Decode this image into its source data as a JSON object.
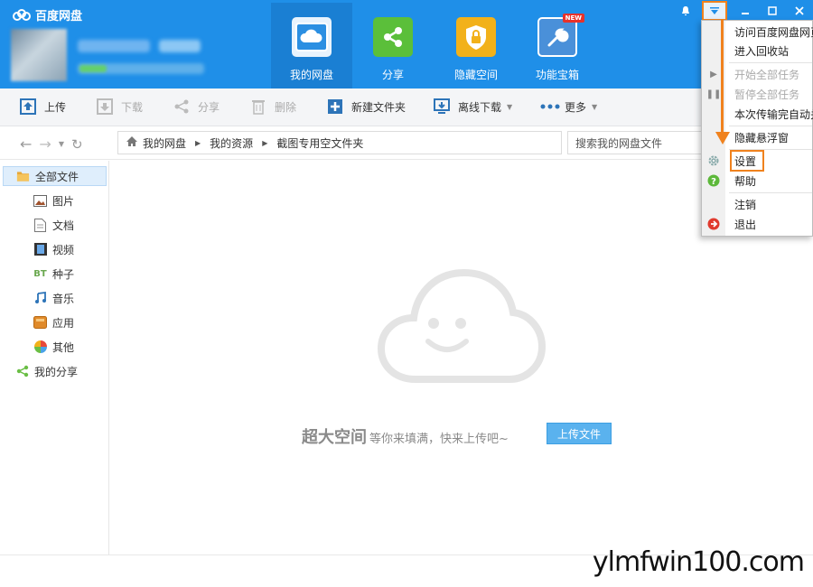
{
  "app": {
    "title": "百度网盘"
  },
  "nav_tabs": [
    {
      "label": "我的网盘",
      "icon": "cloud-icon",
      "active": true
    },
    {
      "label": "分享",
      "icon": "share-icon",
      "active": false
    },
    {
      "label": "隐藏空间",
      "icon": "lock-icon",
      "active": false
    },
    {
      "label": "功能宝箱",
      "icon": "toolbox-icon",
      "active": false,
      "badge": "NEW"
    }
  ],
  "toolbar": {
    "upload": "上传",
    "download": "下载",
    "share": "分享",
    "delete": "删除",
    "new_folder": "新建文件夹",
    "offline_download": "离线下载",
    "more": "更多"
  },
  "breadcrumb": [
    "我的网盘",
    "我的资源",
    "截图专用空文件夹"
  ],
  "search": {
    "placeholder": "搜索我的网盘文件"
  },
  "sidebar": {
    "items": [
      {
        "label": "全部文件",
        "icon": "folder-icon"
      },
      {
        "label": "图片",
        "icon": "image-icon"
      },
      {
        "label": "文档",
        "icon": "document-icon"
      },
      {
        "label": "视频",
        "icon": "video-icon"
      },
      {
        "label": "种子",
        "icon": "bt-icon",
        "icon_text": "BT"
      },
      {
        "label": "音乐",
        "icon": "music-icon"
      },
      {
        "label": "应用",
        "icon": "app-icon"
      },
      {
        "label": "其他",
        "icon": "other-icon"
      },
      {
        "label": "我的分享",
        "icon": "share-icon"
      }
    ]
  },
  "empty_state": {
    "headline": "超大空间",
    "message": "等你来填满，快来上传吧~",
    "button": "上传文件"
  },
  "menu": {
    "items": [
      {
        "label": "访问百度网盘网页"
      },
      {
        "label": "进入回收站"
      },
      {
        "label": "开始全部任务",
        "disabled": true
      },
      {
        "label": "暂停全部任务",
        "disabled": true
      },
      {
        "label": "本次传输完自动关机"
      },
      {
        "label": "隐藏悬浮窗"
      },
      {
        "label": "设置"
      },
      {
        "label": "帮助"
      },
      {
        "label": "注销"
      },
      {
        "label": "退出"
      }
    ]
  },
  "watermark": "ylmfwin100.com",
  "colors": {
    "header_bg": "#1f8fe8",
    "active_tab_bg": "#1a7fd3",
    "highlight": "#f0821e",
    "upload_button": "#5ab2ee"
  }
}
